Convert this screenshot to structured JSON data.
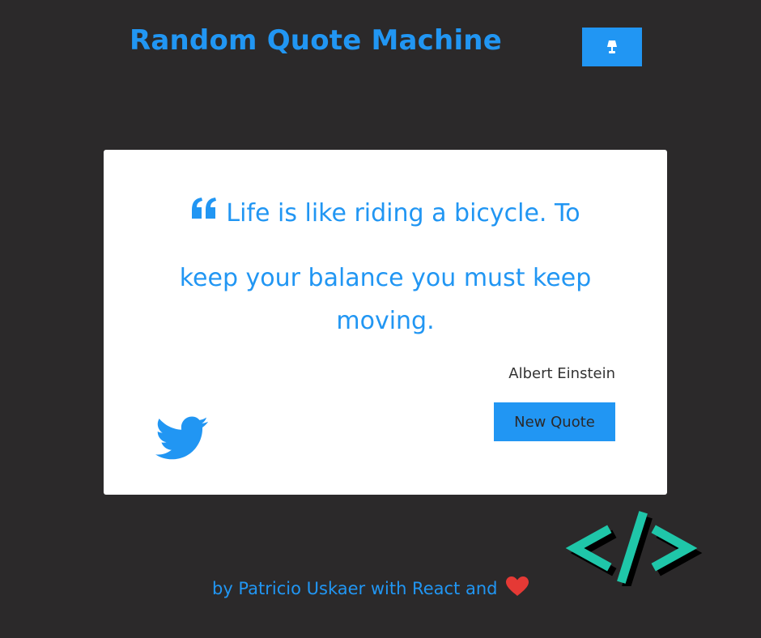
{
  "header": {
    "title": "Random Quote Machine",
    "theme_toggle_icon": "lamp-icon"
  },
  "quote": {
    "line_first": "Life is like riding a bicycle. To",
    "line_rest": "keep your balance you must keep moving.",
    "author": "Albert Einstein",
    "icon": "quote-left-icon"
  },
  "actions": {
    "new_quote_label": "New Quote",
    "tweet_icon": "twitter-icon"
  },
  "footer": {
    "credit": "by Patricio Uskaer with React and",
    "heart_icon": "heart-icon",
    "logo_icon": "code-logo-icon"
  },
  "colors": {
    "background": "#2b292a",
    "accent": "#2196f3",
    "card": "#ffffff",
    "author_text": "#333333",
    "logo_teal": "#1fc6a9",
    "heart": "#e53935"
  }
}
